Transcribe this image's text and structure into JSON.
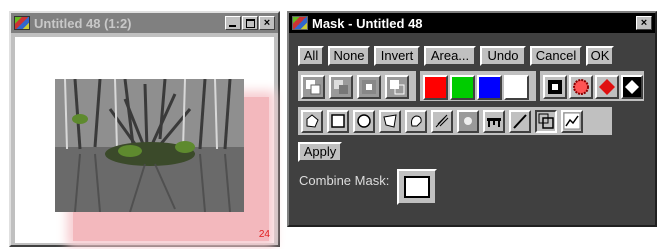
{
  "image_window": {
    "title": "Untitled 48 (1:2)",
    "page_number": "24",
    "controls": {
      "minimize": "_",
      "maximize": "□",
      "close": "×"
    }
  },
  "mask_window": {
    "title": "Mask - Untitled 48",
    "close": "×",
    "buttons": [
      "All",
      "None",
      "Invert",
      "Area...",
      "Undo",
      "Cancel",
      "OK"
    ],
    "apply_label": "Apply",
    "combine_label": "Combine Mask:",
    "swatch_colors": [
      "#ff0000",
      "#00cc00",
      "#0000ff",
      "#ffffff"
    ],
    "icons": {
      "row1": [
        "mask-mode-1-icon",
        "mask-mode-2-icon",
        "mask-mode-3-icon",
        "mask-mode-4-icon"
      ],
      "row1_right": [
        "square-point-icon",
        "starburst-icon",
        "red-diamond-icon",
        "black-diamond-icon"
      ],
      "row2": [
        "flood-fill-icon",
        "rectangle-icon",
        "ellipse-icon",
        "polygon-icon",
        "lasso-icon",
        "feather-icon",
        "soft-brush-icon",
        "table-icon",
        "line-icon",
        "overlap-icon",
        "curve-icon"
      ]
    }
  }
}
